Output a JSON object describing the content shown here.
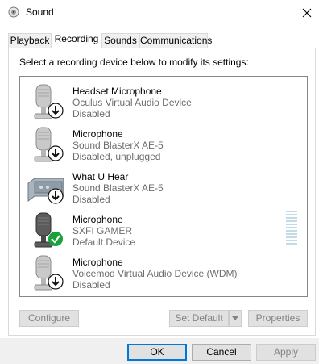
{
  "window": {
    "title": "Sound",
    "close_icon": "close-icon"
  },
  "tabs": [
    {
      "label": "Playback"
    },
    {
      "label": "Recording",
      "active": true
    },
    {
      "label": "Sounds"
    },
    {
      "label": "Communications"
    }
  ],
  "instruction": "Select a recording device below to modify its settings:",
  "devices": [
    {
      "name": "Headset Microphone",
      "sub": "Oculus Virtual Audio Device",
      "status": "Disabled",
      "icon": "microphone-icon",
      "badge": "down-arrow-badge"
    },
    {
      "name": "Microphone",
      "sub": "Sound BlasterX AE-5",
      "status": "Disabled, unplugged",
      "icon": "microphone-icon",
      "badge": "down-arrow-badge"
    },
    {
      "name": "What U Hear",
      "sub": "Sound BlasterX AE-5",
      "status": "Disabled",
      "icon": "soundcard-icon",
      "badge": "down-arrow-badge"
    },
    {
      "name": "Microphone",
      "sub": "SXFI GAMER",
      "status": "Default Device",
      "icon": "microphone-icon",
      "badge": "green-check-badge",
      "level": 0
    },
    {
      "name": "Microphone",
      "sub": "Voicemod Virtual Audio Device (WDM)",
      "status": "Disabled",
      "icon": "microphone-icon",
      "badge": "down-arrow-badge"
    }
  ],
  "buttons": {
    "configure": "Configure",
    "set_default": "Set Default",
    "properties": "Properties",
    "ok": "OK",
    "cancel": "Cancel",
    "apply": "Apply"
  },
  "colors": {
    "accent": "#0078d7",
    "check": "#1aa23a",
    "level_meter": "#c2dbe9"
  }
}
